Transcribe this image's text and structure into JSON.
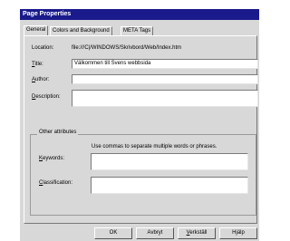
{
  "window": {
    "title": "Page Properties"
  },
  "tabs": [
    {
      "label": "General"
    },
    {
      "label": "Colors and Background"
    },
    {
      "label": "META Tags"
    }
  ],
  "general": {
    "location_label": "Location:",
    "location_value": "file:///C|/WINDOWS/Skrivbord/Web/Index.htm",
    "title_label": "Title:",
    "title_value": "Välkommen till Svens webbsida",
    "author_label": "Author:",
    "author_value": "",
    "description_label": "Description:",
    "description_value": ""
  },
  "other": {
    "group_label": "Other attributes",
    "hint": "Use commas to separate multiple words or phrases.",
    "keywords_label": "Keywords:",
    "keywords_value": "",
    "classification_label": "Classification:",
    "classification_value": ""
  },
  "buttons": {
    "ok": "OK",
    "cancel": "Avbryt",
    "apply": "Verkställ",
    "help": "Hjälp"
  }
}
